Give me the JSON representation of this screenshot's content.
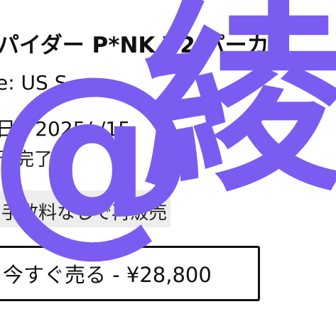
{
  "listing": {
    "title": "パイダー P*NK V2 パーカ",
    "size": "e: US S",
    "date": "日 : 2025/ /15",
    "status": "予完了",
    "resale_note": "手数料なしで再販売",
    "sell_button": "今すぐ売る - ¥28,800"
  },
  "watermark": {
    "text_at": "@",
    "text_char": "綾",
    "color": "#7b5cf0"
  }
}
